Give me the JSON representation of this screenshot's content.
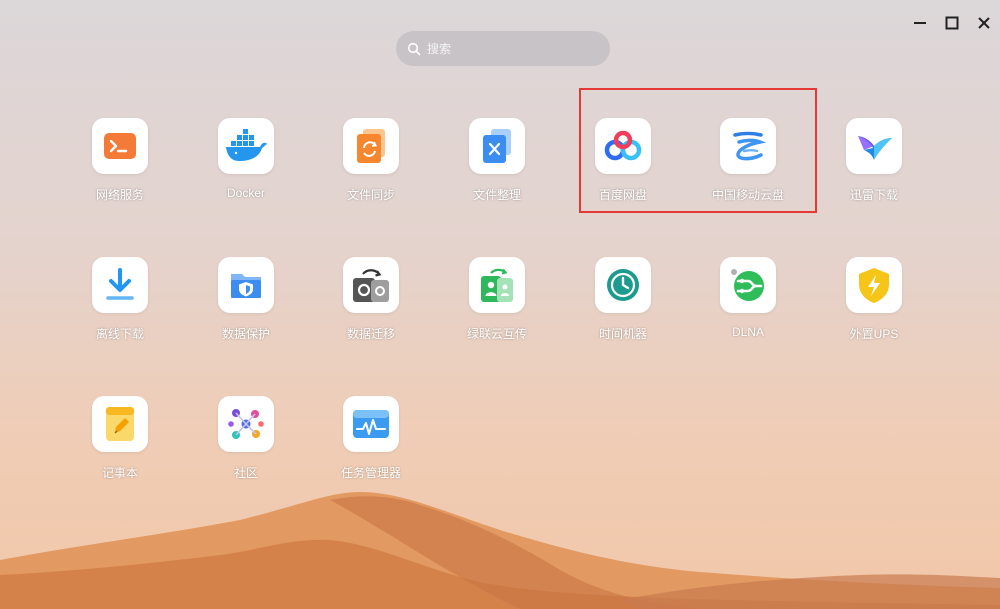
{
  "search": {
    "placeholder": "搜索"
  },
  "window_controls": {
    "minimize": "minimize",
    "maximize": "maximize",
    "close": "close"
  },
  "apps": [
    {
      "label": "网络服务",
      "icon": "terminal-icon",
      "color": "#f37b37"
    },
    {
      "label": "Docker",
      "icon": "docker-icon",
      "color": "#2496ed"
    },
    {
      "label": "文件同步",
      "icon": "file-sync-icon",
      "color": "#f7872e"
    },
    {
      "label": "文件整理",
      "icon": "file-organize-icon",
      "color": "#3b8df0"
    },
    {
      "label": "百度网盘",
      "icon": "baidu-netdisk-icon",
      "color": "#2e6cf6"
    },
    {
      "label": "中国移动云盘",
      "icon": "cmcc-cloud-icon",
      "color": "#2d7fe6"
    },
    {
      "label": "迅雷下载",
      "icon": "xunlei-icon",
      "color": "#1e88e5"
    },
    {
      "label": "离线下载",
      "icon": "download-icon",
      "color": "#2196f3"
    },
    {
      "label": "数据保护",
      "icon": "data-protect-icon",
      "color": "#3d8cf0"
    },
    {
      "label": "数据迁移",
      "icon": "data-migrate-icon",
      "color": "#555555"
    },
    {
      "label": "绿联云互传",
      "icon": "transfer-icon",
      "color": "#2eb85c"
    },
    {
      "label": "时间机器",
      "icon": "time-machine-icon",
      "color": "#1d9b8e"
    },
    {
      "label": "DLNA",
      "icon": "dlna-icon",
      "color": "#2ebd59"
    },
    {
      "label": "外置UPS",
      "icon": "ups-icon",
      "color": "#f5c518"
    },
    {
      "label": "记事本",
      "icon": "notepad-icon",
      "color": "#f7b822"
    },
    {
      "label": "社区",
      "icon": "community-icon",
      "color": "#7b4dd6"
    },
    {
      "label": "任务管理器",
      "icon": "task-manager-icon",
      "color": "#3a9bf0"
    }
  ]
}
